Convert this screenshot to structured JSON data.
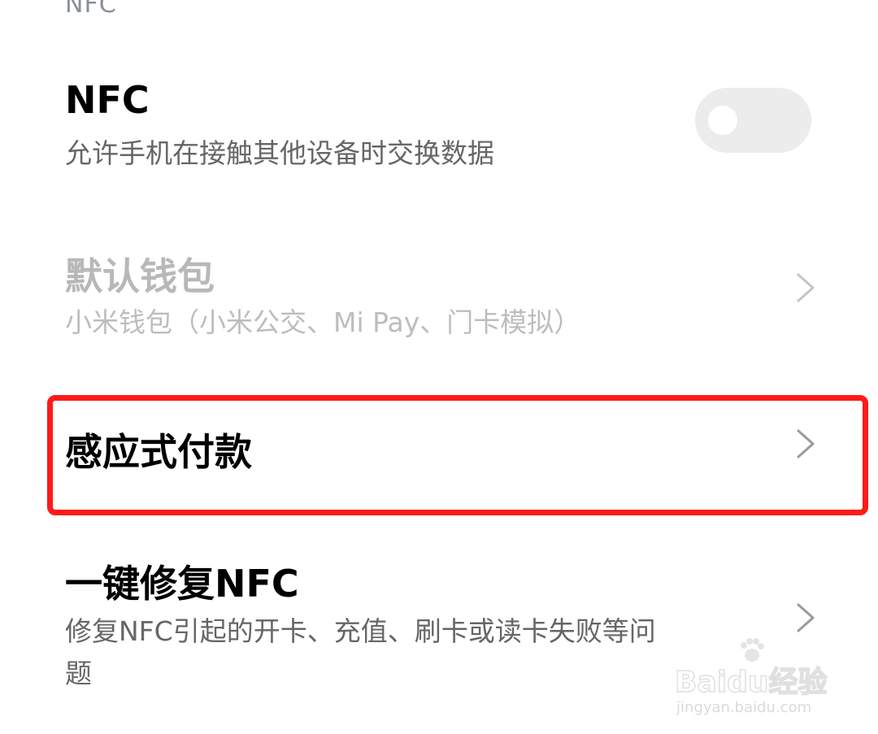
{
  "section": {
    "header": "NFC"
  },
  "rows": [
    {
      "title": "NFC",
      "subtitle": "允许手机在接触其他设备时交换数据",
      "control": "toggle",
      "toggle_on": false
    },
    {
      "title": "默认钱包",
      "subtitle": "小米钱包（小米公交、Mi Pay、门卡模拟）",
      "control": "chevron",
      "disabled": true
    },
    {
      "title": "感应式付款",
      "control": "chevron",
      "highlighted": true
    },
    {
      "title": "一键修复NFC",
      "subtitle_line1": "修复NFC引起的开卡、充值、刷卡或读卡失败等问",
      "subtitle_line2": "题",
      "control": "chevron"
    }
  ],
  "watermark": {
    "brand": "Baidu经验",
    "url": "jingyan.baidu.com"
  },
  "colors": {
    "highlight_border": "#ff1a1a",
    "disabled_text": "#b8b8b8",
    "toggle_off": "#ececec"
  }
}
